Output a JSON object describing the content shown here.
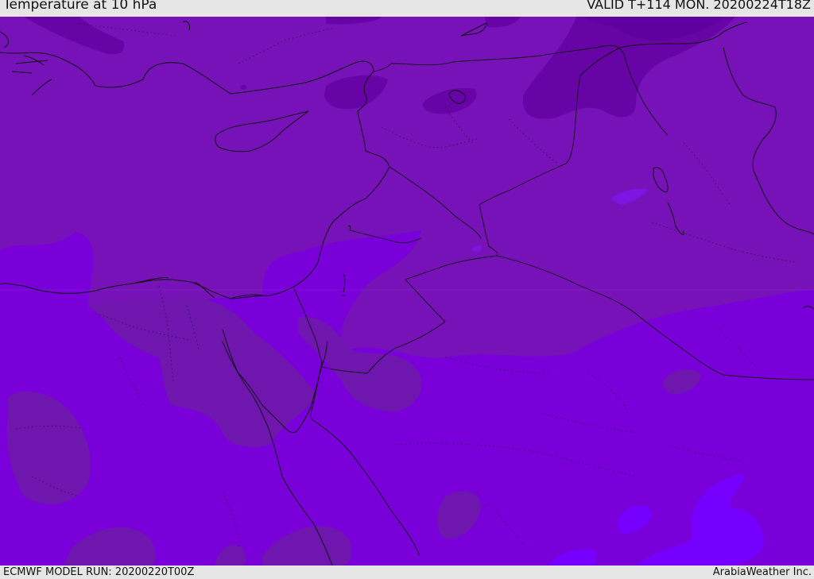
{
  "header": {
    "title": "Temperature at 10 hPa",
    "valid": "VALID T+114 MON. 20200224T18Z"
  },
  "footer": {
    "model_run": "ECMWF MODEL RUN: 20200220T00Z",
    "credit": "ArabiaWeather Inc."
  },
  "colors": {
    "background_band": "#7b13b6",
    "dark_band": "#6300a6",
    "light_band": "#7a00da",
    "lighter_band": "#8a00f0",
    "lightest_band": "#7010ff",
    "mid_band": "#6f1aac",
    "coastline": "#111111"
  }
}
